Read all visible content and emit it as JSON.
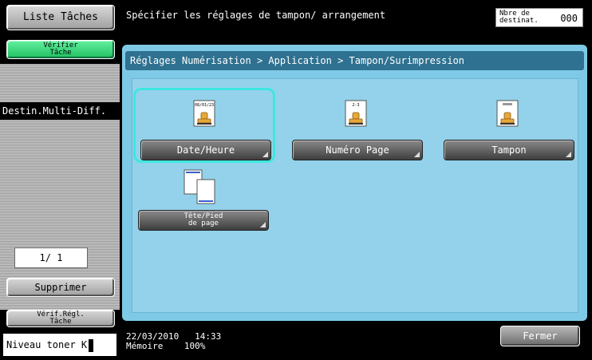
{
  "sidebar": {
    "liste_taches": "Liste Tâches",
    "verifier_tache": "Vérifier\nTâche",
    "destin_multi": "Destin.Multi-Diff.",
    "page_counter": "1/ 1",
    "supprimer": "Supprimer",
    "verif_regl": "Vérif.Régl.\nTâche",
    "toner": "Niveau toner K"
  },
  "header": {
    "title": "Spécifier les réglages de tampon/ arrangement",
    "destinat_label": "Nbre de\ndestinat.",
    "destinat_count": "000"
  },
  "breadcrumb": "Réglages Numérisation > Application > Tampon/Surimpression",
  "options": {
    "date_heure": "Date/Heure",
    "numero_page": "Numéro Page",
    "tampon": "Tampon",
    "tete_pied": "Tête/Pied\nde page"
  },
  "icon_text": {
    "date": "08/01/23",
    "page": "2-3"
  },
  "footer": {
    "date": "22/03/2010",
    "time": "14:33",
    "memoire_label": "Mémoire",
    "memoire_value": "100%",
    "fermer": "Fermer"
  },
  "colors": {
    "panel": "#7ec9e6",
    "breadcrumb": "#2f7190",
    "selection": "#3ee7e0",
    "verify_button": "#20c060"
  }
}
